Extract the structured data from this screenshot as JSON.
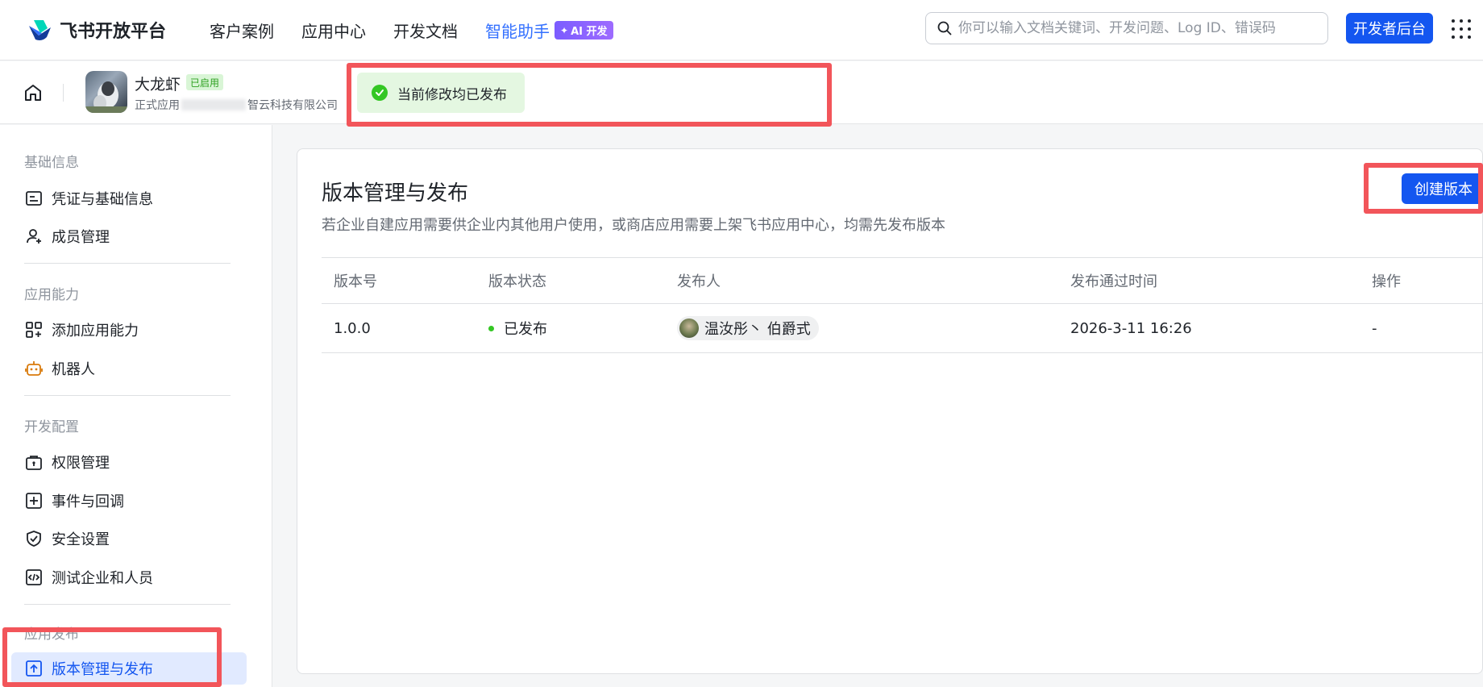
{
  "header": {
    "logo_text": "飞书开放平台",
    "nav": [
      "客户案例",
      "应用中心",
      "开发文档"
    ],
    "ai_link": "智能助手",
    "ai_badge": "AI 开发",
    "search_placeholder": "你可以输入文档关键词、开发问题、Log ID、错误码",
    "dev_console": "开发者后台"
  },
  "app": {
    "name": "大龙虾",
    "status_tag": "已启用",
    "type_prefix": "正式应用",
    "company_suffix": "智云科技有限公司",
    "toast": "当前修改均已发布"
  },
  "sidebar": {
    "sections": [
      {
        "title": "基础信息",
        "items": [
          {
            "label": "凭证与基础信息",
            "icon": "credential-icon"
          },
          {
            "label": "成员管理",
            "icon": "add-member-icon"
          }
        ]
      },
      {
        "title": "应用能力",
        "items": [
          {
            "label": "添加应用能力",
            "icon": "apps-grid-icon"
          },
          {
            "label": "机器人",
            "icon": "robot-icon"
          }
        ]
      },
      {
        "title": "开发配置",
        "items": [
          {
            "label": "权限管理",
            "icon": "permission-icon"
          },
          {
            "label": "事件与回调",
            "icon": "event-icon"
          },
          {
            "label": "安全设置",
            "icon": "shield-icon"
          },
          {
            "label": "测试企业和人员",
            "icon": "code-icon"
          }
        ]
      },
      {
        "title": "应用发布",
        "items": [
          {
            "label": "版本管理与发布",
            "icon": "upload-icon",
            "active": true
          }
        ]
      }
    ]
  },
  "main": {
    "title": "版本管理与发布",
    "description": "若企业自建应用需要供企业内其他用户使用，或商店应用需要上架飞书应用中心，均需先发布版本",
    "create_button": "创建版本",
    "columns": [
      "版本号",
      "版本状态",
      "发布人",
      "发布通过时间",
      "操作"
    ],
    "rows": [
      {
        "version": "1.0.0",
        "status": "已发布",
        "publisher": "温汝彤丶 伯爵式",
        "time": "2026-3-11 16:26",
        "action": "-"
      }
    ]
  },
  "colors": {
    "primary": "#1456f0",
    "success": "#34c724",
    "highlight": "#f2555a"
  }
}
